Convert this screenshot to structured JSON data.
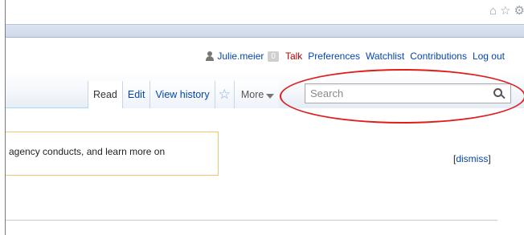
{
  "browser": {
    "icons": [
      {
        "name": "home-icon",
        "glyph": "⌂"
      },
      {
        "name": "star-bookmark-icon",
        "glyph": "☆"
      },
      {
        "name": "settings-icon",
        "glyph": "⚙"
      }
    ]
  },
  "personal_tools": {
    "username": "Julie.meier",
    "notifications": "0",
    "links": [
      "Talk",
      "Preferences",
      "Watchlist",
      "Contributions",
      "Log out"
    ]
  },
  "tabs": {
    "read": "Read",
    "edit": "Edit",
    "history": "View history",
    "watch_glyph": "☆",
    "more": "More"
  },
  "search": {
    "placeholder": "Search",
    "value": ""
  },
  "notice": {
    "text": "agency conducts, and learn more on",
    "dismiss_open": "[",
    "dismiss": "dismiss",
    "dismiss_close": "]"
  },
  "colors": {
    "link": "#0645ad",
    "talk": "#ba0000",
    "annotation": "#e01d1d",
    "notice_border": "#f0c36d"
  }
}
